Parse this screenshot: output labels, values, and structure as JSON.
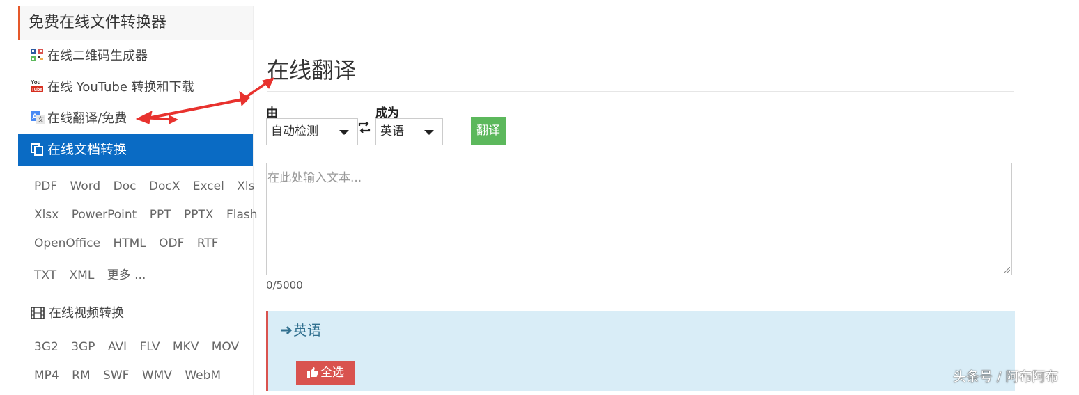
{
  "sidebar": {
    "title": "免费在线文件转换器",
    "links": [
      {
        "label": "在线二维码生成器",
        "icon": "qr-code-icon"
      },
      {
        "label": "在线 YouTube 转换和下载",
        "icon": "youtube-icon"
      },
      {
        "label": "在线翻译/免费",
        "icon": "translate-icon"
      }
    ],
    "active_section": {
      "label": "在线文档转换",
      "icon": "copy-docs-icon"
    },
    "doc_formats": [
      [
        "PDF",
        "Word",
        "Doc",
        "DocX",
        "Excel",
        "Xls"
      ],
      [
        "Xlsx",
        "PowerPoint",
        "PPT",
        "PPTX",
        "Flash"
      ],
      [
        "OpenOffice",
        "HTML",
        "ODF",
        "RTF"
      ],
      [
        "TXT",
        "XML",
        "更多 ..."
      ]
    ],
    "video_section": {
      "label": "在线视频转换",
      "icon": "film-icon"
    },
    "video_formats": [
      [
        "3G2",
        "3GP",
        "AVI",
        "FLV",
        "MKV",
        "MOV"
      ],
      [
        "MP4",
        "RM",
        "SWF",
        "WMV",
        "WebM"
      ]
    ]
  },
  "main": {
    "title": "在线翻译",
    "from_label": "由",
    "from_value": "自动检测",
    "to_label": "成为",
    "to_value": "英语",
    "translate_button": "翻译",
    "input_placeholder": "在此处输入文本...",
    "char_counter": "0/5000",
    "result_header": "英语",
    "select_all_button": "全选"
  },
  "watermark": "头条号 / 阿布阿布",
  "colors": {
    "accent_blue": "#0a6bc4",
    "title_border": "#e5582a",
    "translate_green": "#5cb85c",
    "select_red": "#d9534f",
    "result_bg": "#d9edf7",
    "annotation_red": "#e8322e"
  }
}
